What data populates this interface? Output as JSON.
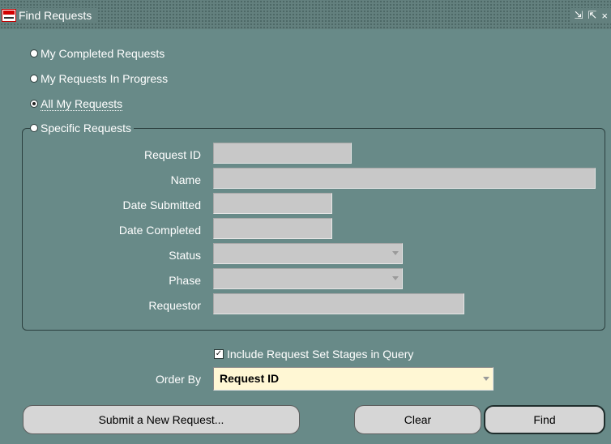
{
  "window": {
    "title": "Find Requests",
    "controls": [
      "⇲",
      "⇱",
      "×"
    ]
  },
  "options": [
    {
      "label": "My Completed Requests",
      "selected": false
    },
    {
      "label": "My Requests In Progress",
      "selected": false
    },
    {
      "label": "All My Requests",
      "selected": true
    },
    {
      "label": "Specific Requests",
      "selected": false
    }
  ],
  "specific": {
    "fields": [
      {
        "label": "Request ID",
        "value": ""
      },
      {
        "label": "Name",
        "value": ""
      },
      {
        "label": "Date Submitted",
        "value": ""
      },
      {
        "label": "Date Completed",
        "value": ""
      },
      {
        "label": "Status",
        "value": ""
      },
      {
        "label": "Phase",
        "value": ""
      },
      {
        "label": "Requestor",
        "value": ""
      }
    ]
  },
  "include_stages": {
    "label": "Include Request Set Stages in Query",
    "checked": true,
    "mark": "✓"
  },
  "order_by": {
    "label": "Order By",
    "value": "Request ID"
  },
  "buttons": {
    "submit": "Submit a New Request...",
    "clear": "Clear",
    "find": "Find"
  },
  "colors": {
    "background": "#688a88",
    "field": "#c8c8c8",
    "order_field": "#fff7d4"
  }
}
